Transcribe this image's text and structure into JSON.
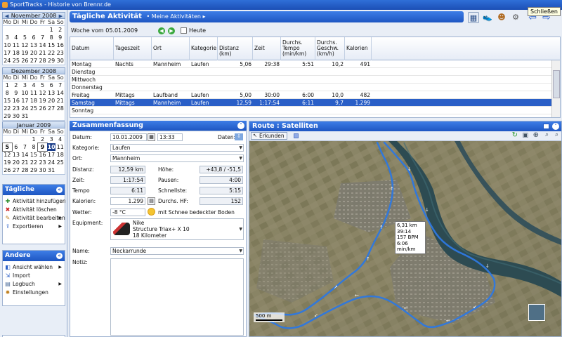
{
  "window": {
    "title": "SportTracks - Historie von Brennr.de",
    "tooltip": "Schließen"
  },
  "calendars": [
    {
      "month": "November 2008",
      "weekdays": [
        "Mo",
        "Di",
        "Mi",
        "Do",
        "Fr",
        "Sa",
        "So"
      ],
      "days": [
        "",
        "",
        "",
        "",
        "",
        "1",
        "2",
        "3",
        "4",
        "5",
        "6",
        "7",
        "8",
        "9",
        "10",
        "11",
        "12",
        "13",
        "14",
        "15",
        "16",
        "17",
        "18",
        "19",
        "20",
        "21",
        "22",
        "23",
        "24",
        "25",
        "26",
        "27",
        "28",
        "29",
        "30"
      ]
    },
    {
      "month": "Dezember 2008",
      "weekdays": [
        "Mo",
        "Di",
        "Mi",
        "Do",
        "Fr",
        "Sa",
        "So"
      ],
      "days": [
        "1",
        "2",
        "3",
        "4",
        "5",
        "6",
        "7",
        "8",
        "9",
        "10",
        "11",
        "12",
        "13",
        "14",
        "15",
        "16",
        "17",
        "18",
        "19",
        "20",
        "21",
        "22",
        "23",
        "24",
        "25",
        "26",
        "27",
        "28",
        "29",
        "30",
        "31"
      ]
    },
    {
      "month": "Januar 2009",
      "weekdays": [
        "Mo",
        "Di",
        "Mi",
        "Do",
        "Fr",
        "Sa",
        "So"
      ],
      "days": [
        "",
        "",
        "",
        "1",
        "2",
        "3",
        "4",
        "5",
        "6",
        "7",
        "8",
        "9",
        "10",
        "11",
        "12",
        "13",
        "14",
        "15",
        "16",
        "17",
        "18",
        "19",
        "20",
        "21",
        "22",
        "23",
        "24",
        "25",
        "26",
        "27",
        "28",
        "29",
        "30",
        "31"
      ],
      "bold": [
        "5",
        "9"
      ],
      "selected": "10"
    }
  ],
  "tasks_daily": {
    "title": "Tägliche Aktivität",
    "items": [
      {
        "label": "Aktivität hinzufügen",
        "icon": "page-add-icon"
      },
      {
        "label": "Aktivität löschen",
        "icon": "delete-x-icon"
      },
      {
        "label": "Aktivität bearbeiten",
        "icon": "pencil-icon"
      },
      {
        "label": "Exportieren",
        "icon": "export-icon"
      }
    ]
  },
  "tasks_other": {
    "title": "Andere Aufgaben",
    "items": [
      {
        "label": "Ansicht wählen",
        "icon": "view-icon"
      },
      {
        "label": "Import",
        "icon": "import-icon"
      },
      {
        "label": "Logbuch",
        "icon": "logbook-icon"
      },
      {
        "label": "Einstellungen",
        "icon": "settings-icon"
      }
    ]
  },
  "header": {
    "title": "Tägliche Aktivität",
    "breadcrumb": "• Meine Aktivitäten  ▸"
  },
  "week": {
    "label": "Woche vom 05.01.2009",
    "today": "Heute"
  },
  "table": {
    "columns": [
      "Datum",
      "Tageszeit",
      "Ort",
      "Kategorie",
      "Distanz (km)",
      "Zeit",
      "Durchs. Tempo (min/km)",
      "Durchs. Geschw. (km/h)",
      "Kalorien"
    ],
    "rows": [
      {
        "datum": "Montag",
        "tageszeit": "Nachts",
        "ort": "Mannheim",
        "kategorie": "Laufen",
        "distanz": "5,06",
        "zeit": "29:38",
        "tempo": "5:51",
        "geschw": "10,2",
        "kalorien": "491"
      },
      {
        "datum": "Dienstag",
        "tageszeit": "",
        "ort": "",
        "kategorie": "",
        "distanz": "",
        "zeit": "",
        "tempo": "",
        "geschw": "",
        "kalorien": ""
      },
      {
        "datum": "Mittwoch",
        "tageszeit": "",
        "ort": "",
        "kategorie": "",
        "distanz": "",
        "zeit": "",
        "tempo": "",
        "geschw": "",
        "kalorien": ""
      },
      {
        "datum": "Donnerstag",
        "tageszeit": "",
        "ort": "",
        "kategorie": "",
        "distanz": "",
        "zeit": "",
        "tempo": "",
        "geschw": "",
        "kalorien": ""
      },
      {
        "datum": "Freitag",
        "tageszeit": "Mittags",
        "ort": "Laufband",
        "kategorie": "Laufen",
        "distanz": "5,00",
        "zeit": "30:00",
        "tempo": "6:00",
        "geschw": "10,0",
        "kalorien": "482"
      },
      {
        "datum": "Samstag",
        "tageszeit": "Mittags",
        "ort": "Mannheim",
        "kategorie": "Laufen",
        "distanz": "12,59",
        "zeit": "1:17:54",
        "tempo": "6:11",
        "geschw": "9,7",
        "kalorien": "1.299"
      },
      {
        "datum": "Sonntag",
        "tageszeit": "",
        "ort": "",
        "kategorie": "",
        "distanz": "",
        "zeit": "",
        "tempo": "",
        "geschw": "",
        "kalorien": ""
      }
    ]
  },
  "summary": {
    "title": "Zusammenfassung",
    "datum_label": "Datum:",
    "datum": "10.01.2009",
    "uhrzeit": "13:33",
    "daten_label": "Daten:",
    "kategorie_label": "Kategorie:",
    "kategorie": "Laufen",
    "ort_label": "Ort:",
    "ort": "Mannheim",
    "distanz_label": "Distanz:",
    "distanz": "12,59 km",
    "hoehe_label": "Höhe:",
    "hoehe": "+43,8 / -51,5",
    "zeit_label": "Zeit:",
    "zeit": "1:17:54",
    "pausen_label": "Pausen:",
    "pausen": "4:00",
    "tempo_label": "Tempo",
    "tempo": "6:11",
    "schnellste_label": "Schnellste:",
    "schnellste": "5:15",
    "kalorien_label": "Kalorien:",
    "kalorien": "1.299",
    "hf_label": "Durchs. HF:",
    "hf": "152",
    "wetter_label": "Wetter:",
    "wetter_temp": "-8 °C",
    "wetter_text": "mit Schnee bedeckter Boden",
    "equipment_label": "Equipment:",
    "equipment_line1": "Nike",
    "equipment_line2": "Structure Triax+ X 10",
    "equipment_line3": "18 Kilometer",
    "name_label": "Name:",
    "name": "Neckarrunde",
    "notiz_label": "Notiz:"
  },
  "map": {
    "title": "Route : Satelliten",
    "explore": "Erkunden",
    "popup": [
      "6,31 km",
      "39:14",
      "157 BPM",
      "6:06 min/km"
    ],
    "scale": "500 m"
  }
}
